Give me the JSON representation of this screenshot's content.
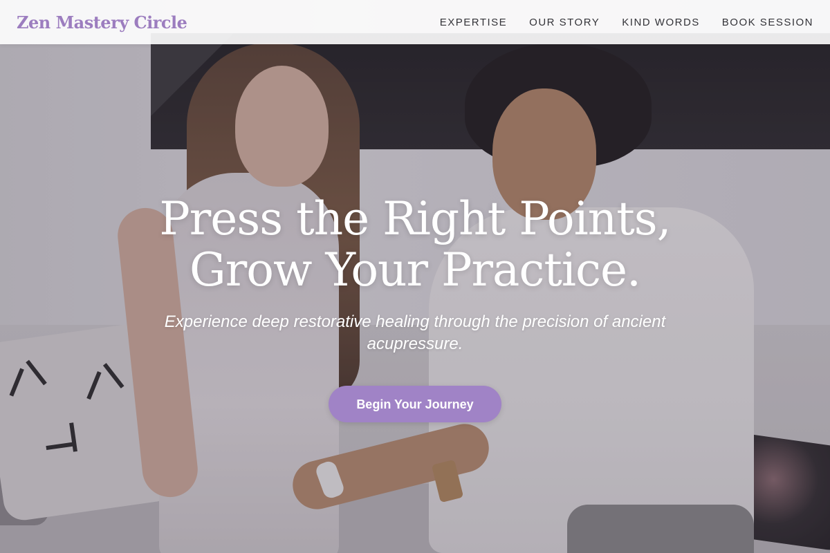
{
  "colors": {
    "brand": "#9c7dbf",
    "cta_background": "#a083c6",
    "nav_text": "#333338",
    "hero_text": "#ffffff"
  },
  "header": {
    "brand": "Zen Mastery Circle",
    "nav": [
      {
        "label": "EXPERTISE"
      },
      {
        "label": "OUR STORY"
      },
      {
        "label": "KIND WORDS"
      },
      {
        "label": "BOOK SESSION"
      }
    ]
  },
  "hero": {
    "title_line_1": "Press the Right Points,",
    "title_line_2": "Grow Your Practice.",
    "subtitle": "Experience deep restorative healing through the precision of ancient acupressure.",
    "cta_label": "Begin Your Journey"
  }
}
